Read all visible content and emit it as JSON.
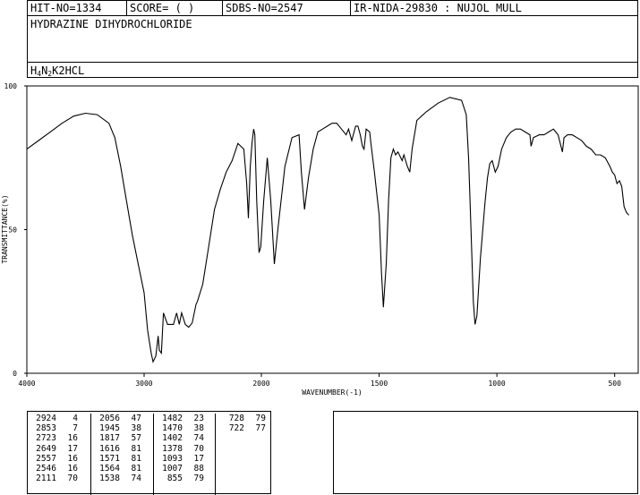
{
  "header": {
    "hit_no": "HIT-NO=1334",
    "score": "SCORE=  (   )",
    "sdbs_no": "SDBS-NO=2547",
    "ir_id": "IR-NIDA-29830 : NUJOL MULL"
  },
  "compound_name": "HYDRAZINE DIHYDROCHLORIDE",
  "formula": {
    "parts": [
      "H",
      "4",
      "N",
      "2",
      "K2HCL"
    ]
  },
  "chart_data": {
    "type": "line",
    "xlabel": "WAVENUMBER(-1)",
    "ylabel": "TRANSMITTANCE(%)",
    "xlim": [
      4000,
      400
    ],
    "ylim": [
      0,
      100
    ],
    "x_ticks": [
      "4000",
      "3000",
      "2000",
      "1500",
      "1000",
      "500"
    ],
    "y_ticks": [
      "100",
      "50",
      "0"
    ],
    "series": [
      {
        "points": [
          [
            4000,
            78
          ],
          [
            3900,
            81
          ],
          [
            3800,
            84
          ],
          [
            3700,
            87
          ],
          [
            3600,
            89.5
          ],
          [
            3500,
            90.5
          ],
          [
            3400,
            90
          ],
          [
            3300,
            87
          ],
          [
            3250,
            82
          ],
          [
            3200,
            72
          ],
          [
            3150,
            60
          ],
          [
            3100,
            48
          ],
          [
            3050,
            38
          ],
          [
            3000,
            28
          ],
          [
            2970,
            15
          ],
          [
            2940,
            7
          ],
          [
            2924,
            4
          ],
          [
            2900,
            6
          ],
          [
            2880,
            13
          ],
          [
            2870,
            8
          ],
          [
            2853,
            7
          ],
          [
            2835,
            21
          ],
          [
            2800,
            17
          ],
          [
            2750,
            17
          ],
          [
            2723,
            21
          ],
          [
            2700,
            17
          ],
          [
            2680,
            21
          ],
          [
            2649,
            17
          ],
          [
            2620,
            16
          ],
          [
            2590,
            17.5
          ],
          [
            2557,
            24
          ],
          [
            2546,
            25
          ],
          [
            2500,
            31
          ],
          [
            2450,
            44
          ],
          [
            2400,
            57
          ],
          [
            2350,
            64
          ],
          [
            2300,
            70
          ],
          [
            2250,
            74
          ],
          [
            2200,
            80
          ],
          [
            2150,
            78
          ],
          [
            2125,
            66
          ],
          [
            2111,
            54
          ],
          [
            2095,
            72
          ],
          [
            2080,
            80
          ],
          [
            2066,
            85
          ],
          [
            2056,
            83
          ],
          [
            2040,
            60
          ],
          [
            2020,
            42
          ],
          [
            2005,
            44
          ],
          [
            1990,
            60
          ],
          [
            1975,
            75
          ],
          [
            1960,
            60
          ],
          [
            1945,
            38
          ],
          [
            1930,
            50
          ],
          [
            1900,
            72
          ],
          [
            1870,
            82
          ],
          [
            1840,
            83
          ],
          [
            1830,
            70
          ],
          [
            1817,
            57
          ],
          [
            1800,
            68
          ],
          [
            1780,
            78
          ],
          [
            1760,
            84
          ],
          [
            1740,
            85
          ],
          [
            1720,
            86
          ],
          [
            1700,
            87
          ],
          [
            1680,
            87
          ],
          [
            1660,
            85
          ],
          [
            1640,
            83
          ],
          [
            1630,
            85
          ],
          [
            1616,
            81
          ],
          [
            1600,
            86
          ],
          [
            1590,
            86
          ],
          [
            1580,
            83
          ],
          [
            1571,
            79
          ],
          [
            1564,
            78
          ],
          [
            1555,
            85
          ],
          [
            1540,
            84
          ],
          [
            1535,
            80
          ],
          [
            1520,
            70
          ],
          [
            1500,
            55
          ],
          [
            1490,
            35
          ],
          [
            1482,
            23
          ],
          [
            1470,
            38
          ],
          [
            1460,
            60
          ],
          [
            1450,
            75
          ],
          [
            1440,
            78
          ],
          [
            1430,
            76
          ],
          [
            1420,
            77
          ],
          [
            1402,
            74
          ],
          [
            1395,
            76
          ],
          [
            1380,
            72
          ],
          [
            1370,
            70
          ],
          [
            1360,
            78
          ],
          [
            1340,
            88
          ],
          [
            1300,
            91
          ],
          [
            1250,
            94
          ],
          [
            1200,
            96
          ],
          [
            1150,
            95
          ],
          [
            1130,
            90
          ],
          [
            1120,
            75
          ],
          [
            1110,
            50
          ],
          [
            1100,
            25
          ],
          [
            1093,
            17
          ],
          [
            1085,
            20
          ],
          [
            1070,
            40
          ],
          [
            1050,
            60
          ],
          [
            1040,
            68
          ],
          [
            1030,
            73
          ],
          [
            1020,
            74
          ],
          [
            1007,
            70
          ],
          [
            995,
            72
          ],
          [
            980,
            78
          ],
          [
            960,
            82
          ],
          [
            940,
            84
          ],
          [
            920,
            85
          ],
          [
            900,
            85
          ],
          [
            880,
            84
          ],
          [
            860,
            83
          ],
          [
            855,
            79
          ],
          [
            845,
            82
          ],
          [
            820,
            83
          ],
          [
            800,
            83
          ],
          [
            780,
            84
          ],
          [
            760,
            85
          ],
          [
            750,
            84
          ],
          [
            740,
            83
          ],
          [
            728,
            79
          ],
          [
            722,
            77
          ],
          [
            715,
            82
          ],
          [
            700,
            83
          ],
          [
            680,
            83
          ],
          [
            660,
            82
          ],
          [
            640,
            81
          ],
          [
            620,
            79
          ],
          [
            600,
            78
          ],
          [
            580,
            76
          ],
          [
            560,
            76
          ],
          [
            540,
            75
          ],
          [
            520,
            72
          ],
          [
            510,
            70
          ],
          [
            500,
            69
          ],
          [
            490,
            66
          ],
          [
            480,
            67
          ],
          [
            470,
            65
          ],
          [
            460,
            58
          ],
          [
            450,
            56
          ],
          [
            440,
            55
          ]
        ]
      }
    ]
  },
  "peak_table": {
    "columns": [
      [
        [
          "2924",
          "4"
        ],
        [
          "2853",
          "7"
        ],
        [
          "2723",
          "16"
        ],
        [
          "2649",
          "17"
        ],
        [
          "2557",
          "16"
        ],
        [
          "2546",
          "16"
        ],
        [
          "2111",
          "70"
        ]
      ],
      [
        [
          "2056",
          "47"
        ],
        [
          "1945",
          "38"
        ],
        [
          "1817",
          "57"
        ],
        [
          "1616",
          "81"
        ],
        [
          "1571",
          "81"
        ],
        [
          "1564",
          "81"
        ],
        [
          "1538",
          "74"
        ]
      ],
      [
        [
          "1482",
          "23"
        ],
        [
          "1470",
          "38"
        ],
        [
          "1402",
          "74"
        ],
        [
          "1378",
          "70"
        ],
        [
          "1093",
          "17"
        ],
        [
          "1007",
          "88"
        ],
        [
          "855",
          "79"
        ]
      ],
      [
        [
          "728",
          "79"
        ],
        [
          "722",
          "77"
        ]
      ]
    ]
  }
}
